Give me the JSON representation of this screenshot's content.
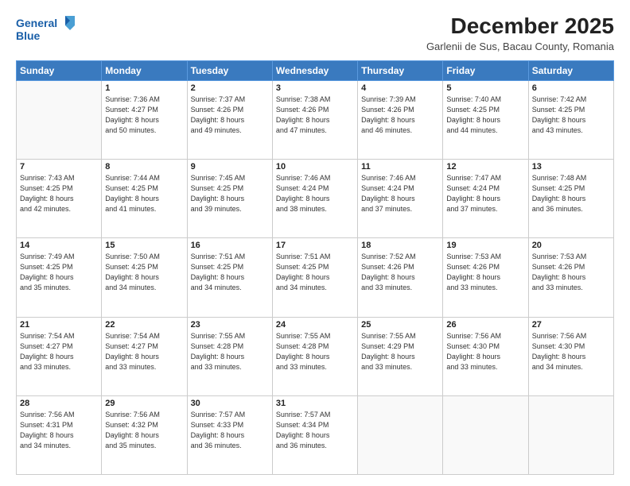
{
  "header": {
    "logo_line1": "General",
    "logo_line2": "Blue",
    "title": "December 2025",
    "subtitle": "Garlenii de Sus, Bacau County, Romania"
  },
  "days_of_week": [
    "Sunday",
    "Monday",
    "Tuesday",
    "Wednesday",
    "Thursday",
    "Friday",
    "Saturday"
  ],
  "weeks": [
    [
      {
        "day": "",
        "info": ""
      },
      {
        "day": "1",
        "info": "Sunrise: 7:36 AM\nSunset: 4:27 PM\nDaylight: 8 hours\nand 50 minutes."
      },
      {
        "day": "2",
        "info": "Sunrise: 7:37 AM\nSunset: 4:26 PM\nDaylight: 8 hours\nand 49 minutes."
      },
      {
        "day": "3",
        "info": "Sunrise: 7:38 AM\nSunset: 4:26 PM\nDaylight: 8 hours\nand 47 minutes."
      },
      {
        "day": "4",
        "info": "Sunrise: 7:39 AM\nSunset: 4:26 PM\nDaylight: 8 hours\nand 46 minutes."
      },
      {
        "day": "5",
        "info": "Sunrise: 7:40 AM\nSunset: 4:25 PM\nDaylight: 8 hours\nand 44 minutes."
      },
      {
        "day": "6",
        "info": "Sunrise: 7:42 AM\nSunset: 4:25 PM\nDaylight: 8 hours\nand 43 minutes."
      }
    ],
    [
      {
        "day": "7",
        "info": "Sunrise: 7:43 AM\nSunset: 4:25 PM\nDaylight: 8 hours\nand 42 minutes."
      },
      {
        "day": "8",
        "info": "Sunrise: 7:44 AM\nSunset: 4:25 PM\nDaylight: 8 hours\nand 41 minutes."
      },
      {
        "day": "9",
        "info": "Sunrise: 7:45 AM\nSunset: 4:25 PM\nDaylight: 8 hours\nand 39 minutes."
      },
      {
        "day": "10",
        "info": "Sunrise: 7:46 AM\nSunset: 4:24 PM\nDaylight: 8 hours\nand 38 minutes."
      },
      {
        "day": "11",
        "info": "Sunrise: 7:46 AM\nSunset: 4:24 PM\nDaylight: 8 hours\nand 37 minutes."
      },
      {
        "day": "12",
        "info": "Sunrise: 7:47 AM\nSunset: 4:24 PM\nDaylight: 8 hours\nand 37 minutes."
      },
      {
        "day": "13",
        "info": "Sunrise: 7:48 AM\nSunset: 4:25 PM\nDaylight: 8 hours\nand 36 minutes."
      }
    ],
    [
      {
        "day": "14",
        "info": "Sunrise: 7:49 AM\nSunset: 4:25 PM\nDaylight: 8 hours\nand 35 minutes."
      },
      {
        "day": "15",
        "info": "Sunrise: 7:50 AM\nSunset: 4:25 PM\nDaylight: 8 hours\nand 34 minutes."
      },
      {
        "day": "16",
        "info": "Sunrise: 7:51 AM\nSunset: 4:25 PM\nDaylight: 8 hours\nand 34 minutes."
      },
      {
        "day": "17",
        "info": "Sunrise: 7:51 AM\nSunset: 4:25 PM\nDaylight: 8 hours\nand 34 minutes."
      },
      {
        "day": "18",
        "info": "Sunrise: 7:52 AM\nSunset: 4:26 PM\nDaylight: 8 hours\nand 33 minutes."
      },
      {
        "day": "19",
        "info": "Sunrise: 7:53 AM\nSunset: 4:26 PM\nDaylight: 8 hours\nand 33 minutes."
      },
      {
        "day": "20",
        "info": "Sunrise: 7:53 AM\nSunset: 4:26 PM\nDaylight: 8 hours\nand 33 minutes."
      }
    ],
    [
      {
        "day": "21",
        "info": "Sunrise: 7:54 AM\nSunset: 4:27 PM\nDaylight: 8 hours\nand 33 minutes."
      },
      {
        "day": "22",
        "info": "Sunrise: 7:54 AM\nSunset: 4:27 PM\nDaylight: 8 hours\nand 33 minutes."
      },
      {
        "day": "23",
        "info": "Sunrise: 7:55 AM\nSunset: 4:28 PM\nDaylight: 8 hours\nand 33 minutes."
      },
      {
        "day": "24",
        "info": "Sunrise: 7:55 AM\nSunset: 4:28 PM\nDaylight: 8 hours\nand 33 minutes."
      },
      {
        "day": "25",
        "info": "Sunrise: 7:55 AM\nSunset: 4:29 PM\nDaylight: 8 hours\nand 33 minutes."
      },
      {
        "day": "26",
        "info": "Sunrise: 7:56 AM\nSunset: 4:30 PM\nDaylight: 8 hours\nand 33 minutes."
      },
      {
        "day": "27",
        "info": "Sunrise: 7:56 AM\nSunset: 4:30 PM\nDaylight: 8 hours\nand 34 minutes."
      }
    ],
    [
      {
        "day": "28",
        "info": "Sunrise: 7:56 AM\nSunset: 4:31 PM\nDaylight: 8 hours\nand 34 minutes."
      },
      {
        "day": "29",
        "info": "Sunrise: 7:56 AM\nSunset: 4:32 PM\nDaylight: 8 hours\nand 35 minutes."
      },
      {
        "day": "30",
        "info": "Sunrise: 7:57 AM\nSunset: 4:33 PM\nDaylight: 8 hours\nand 36 minutes."
      },
      {
        "day": "31",
        "info": "Sunrise: 7:57 AM\nSunset: 4:34 PM\nDaylight: 8 hours\nand 36 minutes."
      },
      {
        "day": "",
        "info": ""
      },
      {
        "day": "",
        "info": ""
      },
      {
        "day": "",
        "info": ""
      }
    ]
  ]
}
